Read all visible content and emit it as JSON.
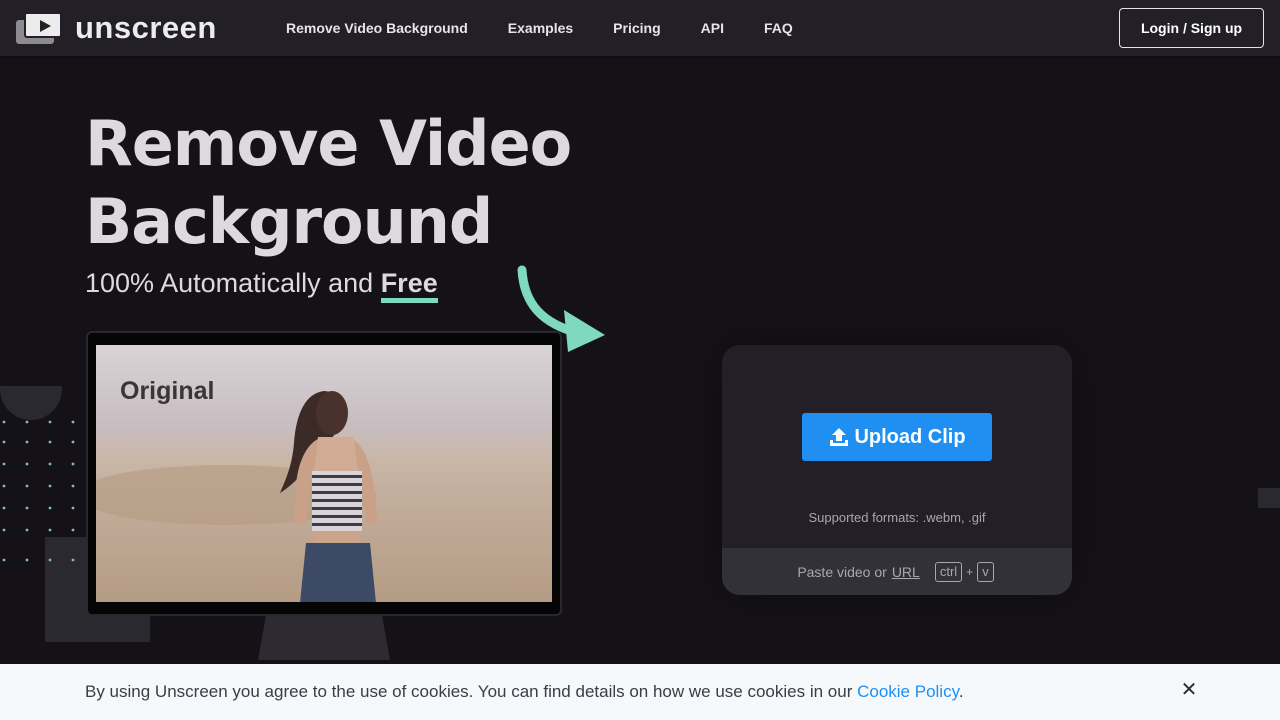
{
  "brand": {
    "name": "unscreen",
    "logo_icon": "video-play-logo-icon"
  },
  "nav": {
    "items": [
      "Remove Video Background",
      "Examples",
      "Pricing",
      "API",
      "FAQ"
    ],
    "login_label": "Login / Sign up"
  },
  "hero": {
    "title_line1": "Remove Video",
    "title_line2": "Background",
    "subtitle_prefix": "100% Automatically and ",
    "subtitle_emphasis": "Free",
    "preview_label": "Original",
    "accent_color": "#7fd9bd"
  },
  "upload": {
    "button_label": "Upload Clip",
    "button_icon": "upload-icon",
    "button_color": "#1f8ff2",
    "formats": "Supported formats: .webm, .gif",
    "paste_prefix": "Paste video or",
    "paste_link": "URL",
    "key_ctrl": "ctrl",
    "key_plus": "+",
    "key_v": "v"
  },
  "cookie": {
    "text": "By using Unscreen you agree to the use of cookies. You can find details on how we use cookies in our ",
    "link": "Cookie Policy",
    "suffix": ".",
    "close_icon": "close-icon"
  }
}
